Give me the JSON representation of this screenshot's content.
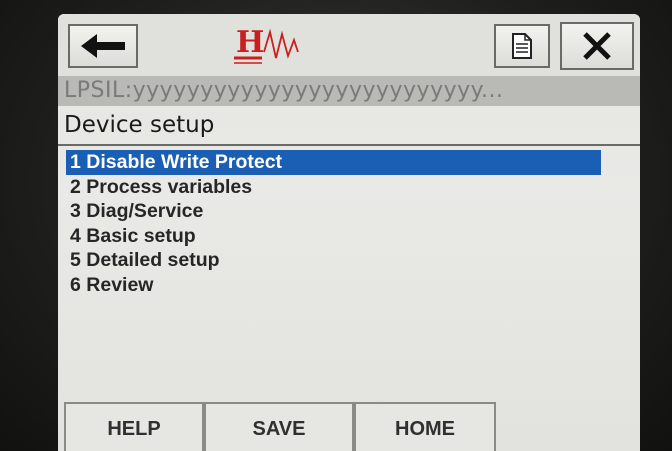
{
  "header": {
    "back_icon": "left-arrow-icon",
    "logo_text": "H",
    "doc_icon": "document-icon",
    "close_icon": "close-icon",
    "accent_color": "#c8201e"
  },
  "tag_line": "LPSIL:yyyyyyyyyyyyyyyyyyyyyyyyyy...",
  "page_title": "Device setup",
  "menu": {
    "selected_color": "#1a5fb4",
    "items": [
      {
        "label": "1 Disable Write Protect"
      },
      {
        "label": "2 Process variables"
      },
      {
        "label": "3 Diag/Service"
      },
      {
        "label": "4 Basic setup"
      },
      {
        "label": "5 Detailed setup"
      },
      {
        "label": "6 Review"
      }
    ]
  },
  "softkeys": {
    "help": "HELP",
    "save": "SAVE",
    "home": "HOME"
  }
}
